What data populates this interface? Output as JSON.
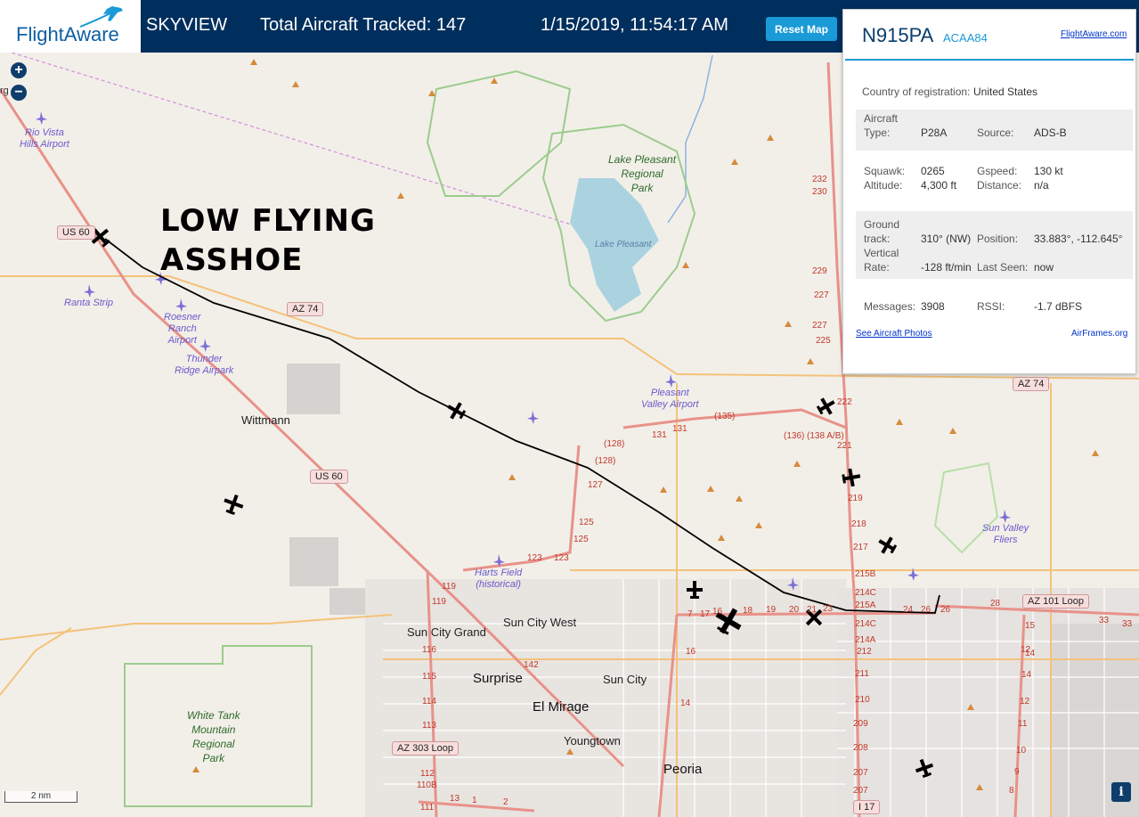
{
  "header": {
    "logo_text": "FlightAware",
    "site_name": "SKYVIEW",
    "total_tracked": "Total Aircraft Tracked: 147",
    "datetime": "1/15/2019, 11:54:17 AM",
    "reset_label": "Reset Map"
  },
  "annotation": {
    "line1": "LOW FLYING",
    "line2": "ASSHOE"
  },
  "map_controls": {
    "zoom_in": "+",
    "zoom_out": "−",
    "scale_label": "2 nm",
    "info": "i",
    "edge_fragment": "rg"
  },
  "map_labels": {
    "rio_vista": "Rio Vista\nHills Airport",
    "ranta": "Ranta Strip",
    "roesner": "Roesner\nRanch\nAirport",
    "thunder": "Thunder\nRidge Airpark",
    "wittmann": "Wittmann",
    "lake_pleasant_park": "Lake Pleasant\nRegional\nPark",
    "lake_pleasant": "Lake Pleasant",
    "pleasant_valley": "Pleasant\nValley Airport",
    "harts": "Harts Field\n(historical)",
    "sun_valley": "Sun Valley\nFliers",
    "sun_city_grand": "Sun City Grand",
    "sun_city_west": "Sun City West",
    "surprise": "Surprise",
    "sun_city": "Sun City",
    "el_mirage": "El Mirage",
    "youngtown": "Youngtown",
    "peoria": "Peoria",
    "white_tank": "White Tank\nMountain\nRegional\nPark",
    "us60_a": "US 60",
    "us60_b": "US 60",
    "az74_a": "AZ 74",
    "az74_b": "AZ 74",
    "az101": "AZ 101 Loop",
    "az303": "AZ 303 Loop",
    "i17": "I 17"
  },
  "exit_labels": [
    "232",
    "230",
    "229",
    "227",
    "227",
    "225",
    "222",
    "221",
    "219",
    "218",
    "217",
    "215B",
    "214C",
    "215A",
    "214C",
    "214A",
    "212",
    "211",
    "210",
    "209",
    "208",
    "207",
    "207",
    "131",
    "131",
    "(135)",
    "(136)",
    "(138 A/B)",
    "(128)",
    "(128)",
    "127",
    "125",
    "125",
    "123",
    "123",
    "119",
    "119",
    "116",
    "115",
    "114",
    "113",
    "112",
    "110B",
    "111",
    "142",
    "16",
    "17",
    "18",
    "19",
    "20",
    "21",
    "23",
    "24",
    "26",
    "26",
    "28",
    "33",
    "33",
    "15",
    "14",
    "14",
    "12",
    "11",
    "10",
    "9",
    "8",
    "7",
    "16",
    "14",
    "12",
    "13",
    "1",
    "2",
    "3"
  ],
  "aircraft_panel": {
    "registration": "N915PA",
    "hex": "ACAA84",
    "fa_link": "FlightAware.com",
    "country_label": "Country of registration:",
    "country": "United States",
    "aircraft_type_label": "Aircraft\nType:",
    "aircraft_type": "P28A",
    "source_label": "Source:",
    "source": "ADS-B",
    "squawk_label": "Squawk:",
    "squawk": "0265",
    "altitude_label": "Altitude:",
    "altitude": "4,300 ft",
    "gspeed_label": "Gspeed:",
    "gspeed": "130 kt",
    "distance_label": "Distance:",
    "distance": "n/a",
    "ground_track_label": "Ground\ntrack:",
    "ground_track": "310° (NW)",
    "position_label": "Position:",
    "position": "33.883°, -112.645°",
    "vertical_rate_label": "Vertical\nRate:",
    "vertical_rate": "-128 ft/min",
    "last_seen_label": "Last Seen:",
    "last_seen": "now",
    "messages_label": "Messages:",
    "messages": "3908",
    "rssi_label": "RSSI:",
    "rssi": "-1.7 dBFS",
    "photos_link": "See Aircraft Photos",
    "airframes_link": "AirFrames.org"
  },
  "colors": {
    "header_bg": "#002f5d",
    "accent": "#1a9ad6",
    "track_line": "#000000",
    "park_border": "#9ccc8c",
    "highway": "#e8928a",
    "water": "#aad3df"
  },
  "icons": [
    "zoom-in-icon",
    "zoom-out-icon",
    "airport-icon",
    "aircraft-icon",
    "peak-icon",
    "info-icon"
  ]
}
